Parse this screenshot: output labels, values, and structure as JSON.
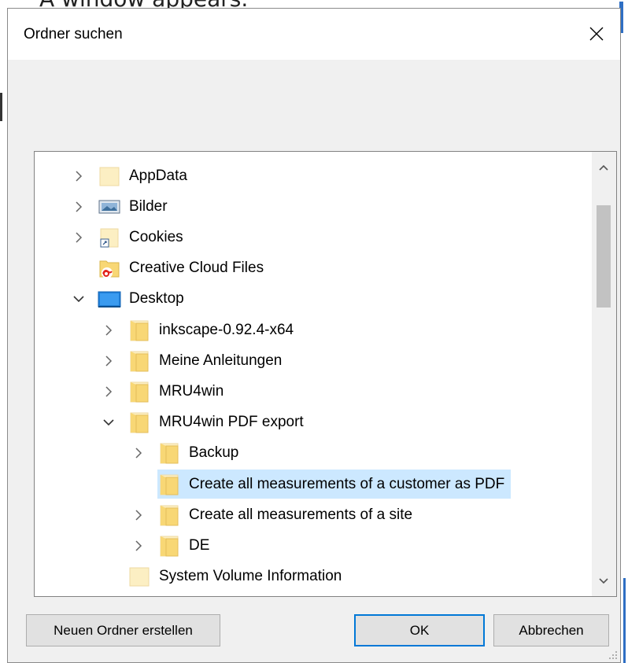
{
  "background": {
    "partial_text": "A window appears."
  },
  "dialog": {
    "title": "Ordner suchen",
    "close_icon": "close-icon"
  },
  "tree": {
    "items": [
      {
        "label": "AppData",
        "level": 0,
        "expander": "collapsed",
        "icon": "folder-plain-icon"
      },
      {
        "label": "Bilder",
        "level": 0,
        "expander": "collapsed",
        "icon": "pictures-folder-icon"
      },
      {
        "label": "Cookies",
        "level": 0,
        "expander": "collapsed",
        "icon": "folder-shortcut-icon"
      },
      {
        "label": "Creative Cloud Files",
        "level": 0,
        "expander": "none",
        "icon": "creative-cloud-folder-icon"
      },
      {
        "label": "Desktop",
        "level": 0,
        "expander": "expanded",
        "icon": "desktop-folder-icon"
      },
      {
        "label": "inkscape-0.92.4-x64",
        "level": 1,
        "expander": "collapsed",
        "icon": "folder-icon"
      },
      {
        "label": "Meine Anleitungen",
        "level": 1,
        "expander": "collapsed",
        "icon": "folder-icon"
      },
      {
        "label": "MRU4win",
        "level": 1,
        "expander": "collapsed",
        "icon": "folder-icon"
      },
      {
        "label": "MRU4win PDF export",
        "level": 1,
        "expander": "expanded",
        "icon": "folder-icon"
      },
      {
        "label": "Backup",
        "level": 2,
        "expander": "collapsed",
        "icon": "folder-icon"
      },
      {
        "label": "Create all measurements of a customer as PDF",
        "level": 2,
        "expander": "none",
        "icon": "folder-icon",
        "selected": true
      },
      {
        "label": "Create all measurements of a site",
        "level": 2,
        "expander": "collapsed",
        "icon": "folder-icon"
      },
      {
        "label": "DE",
        "level": 2,
        "expander": "collapsed",
        "icon": "folder-icon"
      },
      {
        "label": "System Volume Information",
        "level": 1,
        "expander": "none",
        "icon": "folder-plain-icon"
      }
    ]
  },
  "buttons": {
    "new_folder": "Neuen Ordner erstellen",
    "ok": "OK",
    "cancel": "Abbrechen"
  },
  "colors": {
    "selection": "#cce8ff",
    "folder": "#f8d775",
    "accent": "#0078d7"
  }
}
